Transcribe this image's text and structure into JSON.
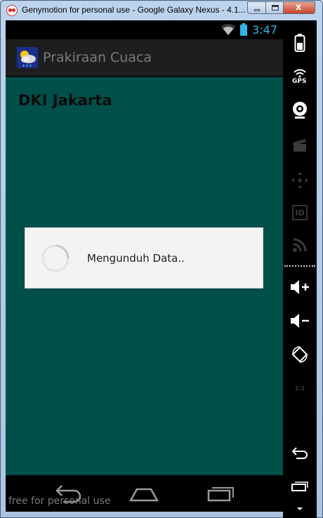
{
  "window": {
    "title": "Genymotion for personal use - Google Galaxy Nexus - 4.1...",
    "close_glyph": "x"
  },
  "status_bar": {
    "time": "3:47"
  },
  "action_bar": {
    "title": "Prakiraan Cuaca",
    "icon": "weather-app-icon"
  },
  "content": {
    "city": "DKI Jakarta"
  },
  "dialog": {
    "message": "Mengunduh Data..",
    "icon": "spinner-icon"
  },
  "nav_bar": {
    "watermark": "free for personal use"
  },
  "sidebar": {
    "gps_label": "GPS",
    "id_label": "ID",
    "ratio_label": "1:1"
  },
  "colors": {
    "content_bg": "#00504a",
    "status_accent": "#33b5e5",
    "action_bar_bg": "#1e1e1e"
  }
}
